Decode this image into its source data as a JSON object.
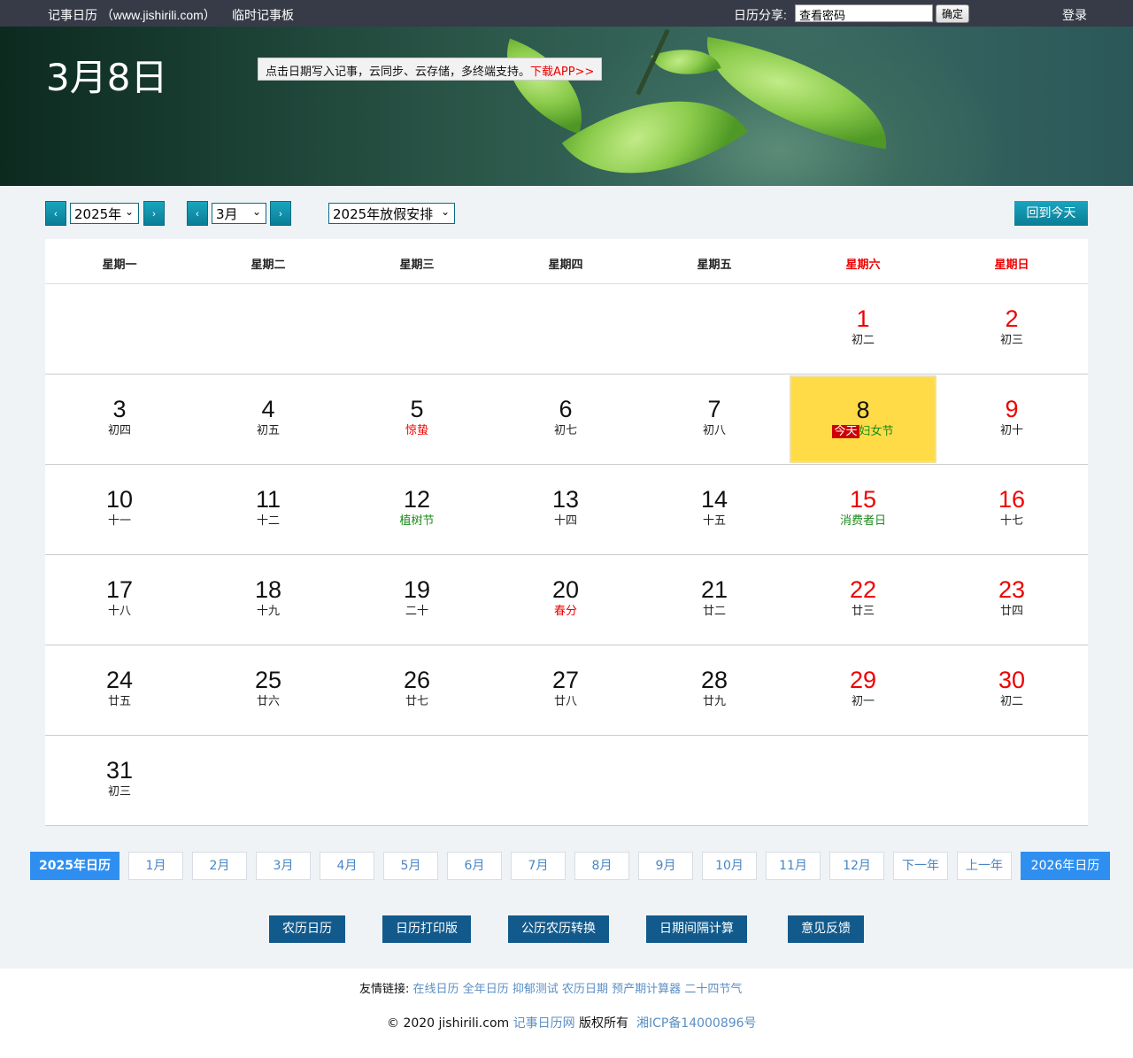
{
  "topbar": {
    "site": "记事日历 （www.jishirili.com）",
    "notepad": "临时记事板",
    "share_label": "日历分享:",
    "share_input_value": "查看密码",
    "share_ok": "确定",
    "login": "登录"
  },
  "banner": {
    "date": "3月8日",
    "tip_text": "点击日期写入记事，云同步、云存储，多终端支持。",
    "tip_app": "下载APP>>"
  },
  "controls": {
    "prev_icon": "‹",
    "next_icon": "›",
    "year": "2025年",
    "month": "3月",
    "holiday": "2025年放假安排",
    "caret": "⌄",
    "today_button": "回到今天"
  },
  "calendar": {
    "weekdays": [
      "星期一",
      "星期二",
      "星期三",
      "星期四",
      "星期五",
      "星期六",
      "星期日"
    ],
    "today_tag": "今天",
    "today_festival": "妇女节",
    "rows": [
      [
        null,
        null,
        null,
        null,
        null,
        {
          "d": "1",
          "l": "初二"
        },
        {
          "d": "2",
          "l": "初三"
        }
      ],
      [
        {
          "d": "3",
          "l": "初四"
        },
        {
          "d": "4",
          "l": "初五"
        },
        {
          "d": "5",
          "l": "惊蛰"
        },
        {
          "d": "6",
          "l": "初七"
        },
        {
          "d": "7",
          "l": "初八"
        },
        {
          "d": "8",
          "l": ""
        },
        {
          "d": "9",
          "l": "初十"
        }
      ],
      [
        {
          "d": "10",
          "l": "十一"
        },
        {
          "d": "11",
          "l": "十二"
        },
        {
          "d": "12",
          "l": "植树节"
        },
        {
          "d": "13",
          "l": "十四"
        },
        {
          "d": "14",
          "l": "十五"
        },
        {
          "d": "15",
          "l": "消费者日"
        },
        {
          "d": "16",
          "l": "十七"
        }
      ],
      [
        {
          "d": "17",
          "l": "十八"
        },
        {
          "d": "18",
          "l": "十九"
        },
        {
          "d": "19",
          "l": "二十"
        },
        {
          "d": "20",
          "l": "春分"
        },
        {
          "d": "21",
          "l": "廿二"
        },
        {
          "d": "22",
          "l": "廿三"
        },
        {
          "d": "23",
          "l": "廿四"
        }
      ],
      [
        {
          "d": "24",
          "l": "廿五"
        },
        {
          "d": "25",
          "l": "廿六"
        },
        {
          "d": "26",
          "l": "廿七"
        },
        {
          "d": "27",
          "l": "廿八"
        },
        {
          "d": "28",
          "l": "廿九"
        },
        {
          "d": "29",
          "l": "初一"
        },
        {
          "d": "30",
          "l": "初二"
        }
      ],
      [
        {
          "d": "31",
          "l": "初三"
        },
        null,
        null,
        null,
        null,
        null,
        null
      ]
    ]
  },
  "month_bar": {
    "this_year": "2025年日历",
    "months": [
      "1月",
      "2月",
      "3月",
      "4月",
      "5月",
      "6月",
      "7月",
      "8月",
      "9月",
      "10月",
      "11月",
      "12月"
    ],
    "next_year": "下一年",
    "prev_year": "上一年",
    "next_year_cal": "2026年日历"
  },
  "tools": [
    "农历日历",
    "日历打印版",
    "公历农历转换",
    "日期间隔计算",
    "意见反馈"
  ],
  "footer": {
    "links_label": "友情链接:",
    "links": [
      "在线日历",
      "全年日历",
      "抑郁测试",
      "农历日期",
      "预产期计算器",
      "二十四节气"
    ],
    "copy_prefix": "© 2020 jishirili.com",
    "copy_link": "记事日历网",
    "copy_suffix": "版权所有",
    "icp": "湘ICP备14000896号"
  },
  "colors": {
    "topbar": "#363b47",
    "accent_teal": "#0a7d95",
    "weekend_red": "#ee0000",
    "festival_green": "#1b8a1b",
    "today_yellow": "#ffdc47",
    "month_blue": "#2f8ff0",
    "tool_blue": "#125a8c"
  }
}
